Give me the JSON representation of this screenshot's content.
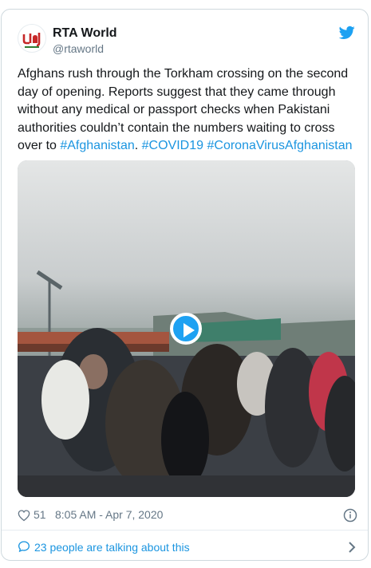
{
  "tweet": {
    "author": {
      "display_name": "RTA World",
      "handle": "@rtaworld"
    },
    "text": {
      "body": "Afghans rush through the Torkham crossing on the second day of opening. Reports suggest that they came through without any medical or passport checks when Pakistani authorities couldn’t contain the numbers waiting to cross over to ",
      "hashtag1": "#Afghanistan",
      "sep": ". ",
      "hashtag2": "#COVID19",
      "space": " ",
      "hashtag3": "#CoronaVirusAfghanistan"
    },
    "media": {
      "kind": "video",
      "play_icon": "play-icon"
    },
    "footer": {
      "like_count": "51",
      "timestamp": "8:05 AM - Apr 7, 2020"
    },
    "conversation": {
      "label": "23 people are talking about this"
    }
  },
  "colors": {
    "link": "#1b95e0",
    "play_button": "#1da1f2",
    "muted_text": "#657786",
    "border": "#cfd9de"
  }
}
